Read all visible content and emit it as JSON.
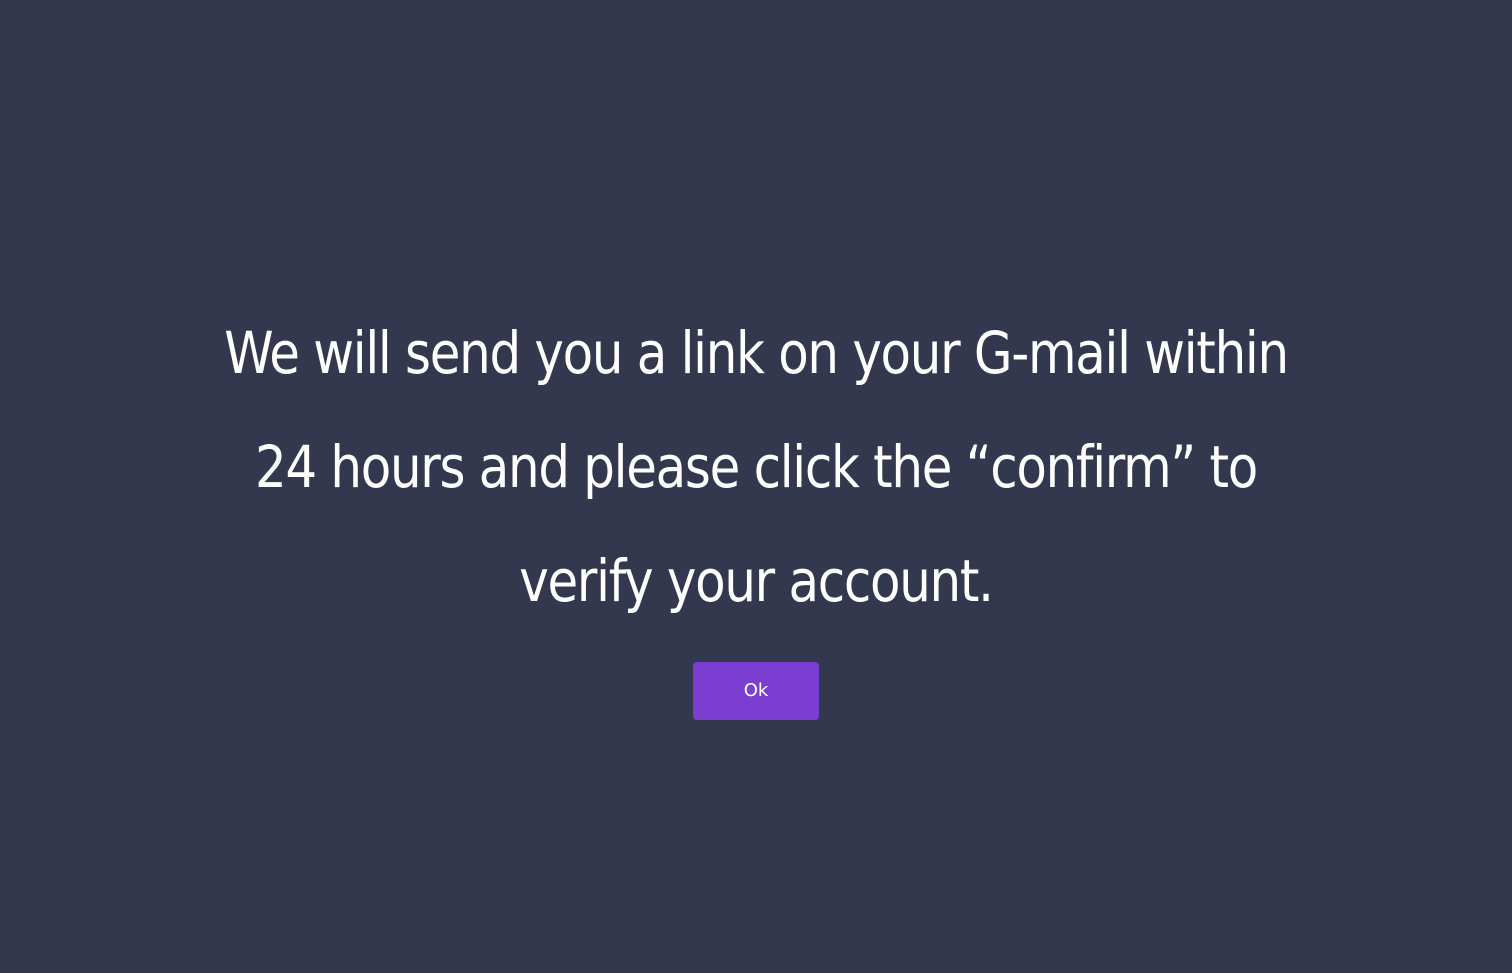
{
  "dialog": {
    "message": "We will send you a link on your G-mail within 24 hours and please click the “confirm” to verify your account.",
    "ok_label": "Ok"
  },
  "colors": {
    "background": "#33384f",
    "accent": "#7a3fd1",
    "text": "#ffffff"
  }
}
